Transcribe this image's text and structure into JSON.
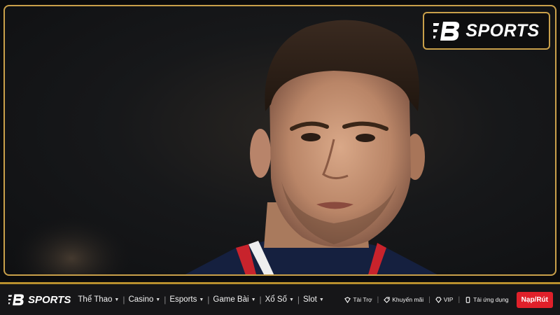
{
  "brand": {
    "name": "SPORTS",
    "accent_color": "#c9a04a",
    "cta_color": "#e0202a"
  },
  "hero": {
    "image": "portrait-photo-footballer"
  },
  "nav": {
    "menu": [
      {
        "label": "Thể Thao",
        "has_dropdown": true
      },
      {
        "label": "Casino",
        "has_dropdown": true
      },
      {
        "label": "Esports",
        "has_dropdown": true
      },
      {
        "label": "Game Bài",
        "has_dropdown": true
      },
      {
        "label": "Xổ Số",
        "has_dropdown": true
      },
      {
        "label": "Slot",
        "has_dropdown": true
      }
    ],
    "utilities": [
      {
        "label": "Tài Trợ",
        "icon": "sponsor-icon"
      },
      {
        "label": "Khuyến mãi",
        "icon": "tag-icon"
      },
      {
        "label": "VIP",
        "icon": "diamond-icon"
      },
      {
        "label": "Tải ứng dụng",
        "icon": "phone-icon"
      }
    ],
    "cta_label": "Nạp/Rút"
  }
}
